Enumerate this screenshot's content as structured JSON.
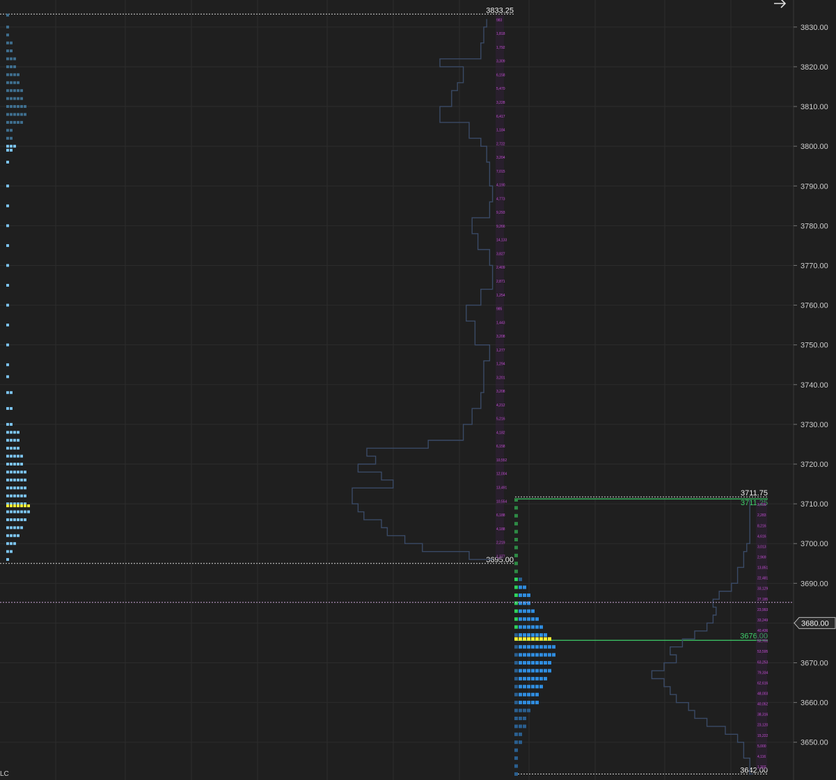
{
  "chart_data": {
    "type": "market-profile",
    "ylim": [
      3640.5,
      3836.8
    ],
    "grid": true,
    "price_axis": {
      "ticks": [
        "3650.00",
        "3660.00",
        "3670.00",
        "3680.00",
        "3690.00",
        "3700.00",
        "3710.00",
        "3720.00",
        "3730.00",
        "3740.00",
        "3750.00",
        "3760.00",
        "3770.00",
        "3780.00",
        "3790.00",
        "3800.00",
        "3810.00",
        "3820.00",
        "3830.00"
      ],
      "current_price": "3680.00"
    },
    "profiles": [
      {
        "high_label": "3833.25",
        "low_label": "3695.00",
        "high": 3833.25,
        "low": 3695.0,
        "poc": 3709.5,
        "tpo_profile": [
          [
            3833,
            1
          ],
          [
            3830,
            1
          ],
          [
            3828,
            1
          ],
          [
            3826,
            2
          ],
          [
            3824,
            2
          ],
          [
            3822,
            3
          ],
          [
            3820,
            3
          ],
          [
            3818,
            4
          ],
          [
            3816,
            4
          ],
          [
            3814,
            5
          ],
          [
            3812,
            5
          ],
          [
            3810,
            6
          ],
          [
            3808,
            6
          ],
          [
            3806,
            5
          ],
          [
            3804,
            2
          ],
          [
            3802,
            2
          ],
          [
            3800,
            3
          ],
          [
            3799,
            2
          ],
          [
            3796,
            1
          ],
          [
            3790,
            1
          ],
          [
            3785,
            1
          ],
          [
            3780,
            1
          ],
          [
            3775,
            1
          ],
          [
            3770,
            1
          ],
          [
            3765,
            1
          ],
          [
            3760,
            1
          ],
          [
            3755,
            1
          ],
          [
            3750,
            1
          ],
          [
            3745,
            1
          ],
          [
            3742,
            1
          ],
          [
            3738,
            2
          ],
          [
            3734,
            2
          ],
          [
            3730,
            2
          ],
          [
            3728,
            4
          ],
          [
            3726,
            4
          ],
          [
            3724,
            4
          ],
          [
            3722,
            5
          ],
          [
            3720,
            5
          ],
          [
            3718,
            6
          ],
          [
            3716,
            6
          ],
          [
            3714,
            6
          ],
          [
            3712,
            6
          ],
          [
            3710,
            6
          ],
          [
            3709.5,
            7
          ],
          [
            3708,
            7
          ],
          [
            3706,
            6
          ],
          [
            3704,
            5
          ],
          [
            3702,
            4
          ],
          [
            3700,
            3
          ],
          [
            3698,
            2
          ],
          [
            3696,
            1
          ]
        ],
        "volume_profile": [
          [
            3832,
            4
          ],
          [
            3830,
            5
          ],
          [
            3826,
            6
          ],
          [
            3822,
            20
          ],
          [
            3820,
            12
          ],
          [
            3816,
            14
          ],
          [
            3814,
            16
          ],
          [
            3810,
            20
          ],
          [
            3806,
            10
          ],
          [
            3802,
            6
          ],
          [
            3800,
            4
          ],
          [
            3796,
            3
          ],
          [
            3790,
            2
          ],
          [
            3786,
            3
          ],
          [
            3782,
            9
          ],
          [
            3778,
            7
          ],
          [
            3774,
            3
          ],
          [
            3770,
            2
          ],
          [
            3764,
            6
          ],
          [
            3760,
            11
          ],
          [
            3756,
            8
          ],
          [
            3750,
            3
          ],
          [
            3746,
            5
          ],
          [
            3742,
            5
          ],
          [
            3738,
            6
          ],
          [
            3734,
            9
          ],
          [
            3730,
            12
          ],
          [
            3726,
            24
          ],
          [
            3724,
            45
          ],
          [
            3722,
            42
          ],
          [
            3720,
            48
          ],
          [
            3718,
            40
          ],
          [
            3716,
            36
          ],
          [
            3714,
            50
          ],
          [
            3712,
            50
          ],
          [
            3710,
            48
          ],
          [
            3708,
            46
          ],
          [
            3706,
            40
          ],
          [
            3704,
            38
          ],
          [
            3702,
            32
          ],
          [
            3700,
            26
          ],
          [
            3698,
            10
          ],
          [
            3696,
            2
          ]
        ],
        "volume_labels": [
          "983",
          "1,818",
          "1,792",
          "3,309",
          "6,158",
          "5,470",
          "3,228",
          "6,417",
          "1,184",
          "2,722",
          "3,204",
          "7,015",
          "4,190",
          "4,773",
          "9,293",
          "9,266",
          "14,133",
          "3,827",
          "2,409",
          "2,871",
          "1,254",
          "985",
          "1,443",
          "3,208",
          "1,277",
          "1,294",
          "3,201",
          "3,208",
          "4,212",
          "5,216",
          "4,182",
          "6,158",
          "10,552",
          "12,004",
          "13,491",
          "10,554",
          "6,188",
          "4,188",
          "2,219",
          "1,277"
        ]
      },
      {
        "high_label": "3711.75",
        "low_label": "3642.00",
        "poc_label": "3676.00",
        "va_high_label": "3711.25",
        "high": 3711.75,
        "low": 3642.0,
        "poc": 3676.0,
        "va_high": 3711.25,
        "tpo_profile": [
          [
            3711,
            1
          ],
          [
            3709,
            1
          ],
          [
            3707,
            1
          ],
          [
            3705,
            1
          ],
          [
            3703,
            1
          ],
          [
            3701,
            1
          ],
          [
            3699,
            1
          ],
          [
            3697,
            1
          ],
          [
            3695,
            1
          ],
          [
            3693,
            1
          ],
          [
            3691,
            2
          ],
          [
            3689,
            3
          ],
          [
            3687,
            4
          ],
          [
            3685,
            4
          ],
          [
            3683,
            5
          ],
          [
            3681,
            6
          ],
          [
            3679,
            7
          ],
          [
            3677,
            8
          ],
          [
            3676,
            9
          ],
          [
            3674,
            10
          ],
          [
            3672,
            10
          ],
          [
            3670,
            9
          ],
          [
            3668,
            9
          ],
          [
            3666,
            8
          ],
          [
            3664,
            7
          ],
          [
            3662,
            6
          ],
          [
            3660,
            6
          ],
          [
            3658,
            4
          ],
          [
            3656,
            3
          ],
          [
            3654,
            3
          ],
          [
            3652,
            2
          ],
          [
            3650,
            2
          ],
          [
            3648,
            1
          ],
          [
            3646,
            1
          ],
          [
            3644,
            1
          ],
          [
            3642,
            1
          ]
        ],
        "volume_profile": [
          [
            3711,
            2
          ],
          [
            3705,
            2
          ],
          [
            3700,
            3
          ],
          [
            3698,
            4
          ],
          [
            3694,
            6
          ],
          [
            3690,
            8
          ],
          [
            3688,
            12
          ],
          [
            3686,
            14
          ],
          [
            3684,
            13
          ],
          [
            3682,
            14
          ],
          [
            3680,
            16
          ],
          [
            3678,
            20
          ],
          [
            3676,
            24
          ],
          [
            3674,
            28
          ],
          [
            3672,
            26
          ],
          [
            3670,
            30
          ],
          [
            3668,
            34
          ],
          [
            3666,
            30
          ],
          [
            3664,
            28
          ],
          [
            3662,
            26
          ],
          [
            3660,
            22
          ],
          [
            3658,
            20
          ],
          [
            3656,
            16
          ],
          [
            3654,
            10
          ],
          [
            3652,
            6
          ],
          [
            3650,
            4
          ],
          [
            3646,
            2
          ],
          [
            3642,
            1
          ]
        ],
        "volume_labels": [
          "3,799",
          "2,283",
          "8,216",
          "4,616",
          "3,013",
          "2,969",
          "13,851",
          "22,481",
          "33,129",
          "27,185",
          "23,993",
          "33,249",
          "40,436",
          "52,701",
          "53,595",
          "63,253",
          "79,334",
          "62,616",
          "48,003",
          "40,052",
          "38,316",
          "23,120",
          "15,222",
          "5,000",
          "4,116",
          "1,302"
        ]
      }
    ]
  },
  "overlays": {
    "top_right_arrow": "arrow-right-icon",
    "bottom_left_fragment": "LC"
  },
  "colors": {
    "background": "#1f1f1f",
    "grid": "#2c2c2c",
    "tpo_dim": "#3f6f8f",
    "tpo_light": "#7cc4f0",
    "tpo_bright": "#2f8de0",
    "tpo_green": "#2ed15c",
    "poc": "#ffee33",
    "volume_line": "#3a4a66",
    "volume_labels": "#c64fd6",
    "level_green": "#3fcf6a",
    "range_line": "#d9d9d9",
    "current_price_line": "#c9a6d6",
    "axis_text": "#cfcfcf"
  }
}
